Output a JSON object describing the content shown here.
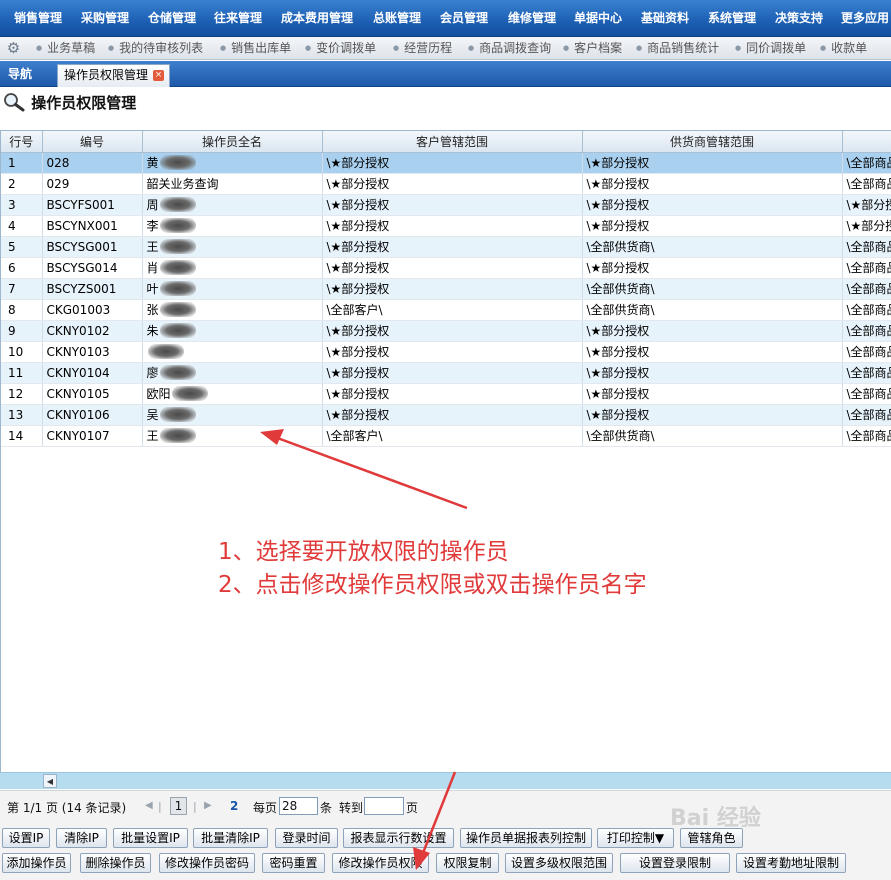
{
  "menu": [
    "销售管理",
    "采购管理",
    "仓储管理",
    "往来管理",
    "成本费用管理",
    "总账管理",
    "会员管理",
    "维修管理",
    "单据中心",
    "基础资料",
    "系统管理",
    "决策支持",
    "更多应用"
  ],
  "quickbar": [
    "业务草稿",
    "我的待审核列表",
    "销售出库单",
    "变价调拨单",
    "经营历程",
    "商品调拨查询",
    "客户档案",
    "商品销售统计",
    "同价调拨单",
    "收款单"
  ],
  "tabs": {
    "nav": "导航",
    "active": "操作员权限管理",
    "close_glyph": "×"
  },
  "page_title": "操作员权限管理",
  "grid": {
    "columns": [
      "行号",
      "编号",
      "操作员全名",
      "客户管辖范围",
      "供货商管辖范围",
      ""
    ],
    "rows": [
      {
        "no": "1",
        "code": "028",
        "name": "黄",
        "cust": "\\★部分授权",
        "supp": "\\★部分授权",
        "other": "\\全部商品"
      },
      {
        "no": "2",
        "code": "029",
        "name": "韶关业务查询",
        "cust": "\\★部分授权",
        "supp": "\\★部分授权",
        "other": "\\全部商品"
      },
      {
        "no": "3",
        "code": "BSCYFS001",
        "name": "周",
        "cust": "\\★部分授权",
        "supp": "\\★部分授权",
        "other": "\\★部分授"
      },
      {
        "no": "4",
        "code": "BSCYNX001",
        "name": "李",
        "cust": "\\★部分授权",
        "supp": "\\★部分授权",
        "other": "\\★部分授"
      },
      {
        "no": "5",
        "code": "BSCYSG001",
        "name": "王",
        "cust": "\\★部分授权",
        "supp": "\\全部供货商\\",
        "other": "\\全部商品"
      },
      {
        "no": "6",
        "code": "BSCYSG014",
        "name": "肖",
        "cust": "\\★部分授权",
        "supp": "\\★部分授权",
        "other": "\\全部商品"
      },
      {
        "no": "7",
        "code": "BSCYZS001",
        "name": "叶",
        "cust": "\\★部分授权",
        "supp": "\\全部供货商\\",
        "other": "\\全部商品"
      },
      {
        "no": "8",
        "code": "CKG01003",
        "name": "张",
        "cust": "\\全部客户\\",
        "supp": "\\全部供货商\\",
        "other": "\\全部商品"
      },
      {
        "no": "9",
        "code": "CKNY0102",
        "name": "朱",
        "cust": "\\★部分授权",
        "supp": "\\★部分授权",
        "other": "\\全部商品"
      },
      {
        "no": "10",
        "code": "CKNY0103",
        "name": "",
        "cust": "\\★部分授权",
        "supp": "\\★部分授权",
        "other": "\\全部商品"
      },
      {
        "no": "11",
        "code": "CKNY0104",
        "name": "廖",
        "cust": "\\★部分授权",
        "supp": "\\★部分授权",
        "other": "\\全部商品"
      },
      {
        "no": "12",
        "code": "CKNY0105",
        "name": "欧阳",
        "cust": "\\★部分授权",
        "supp": "\\★部分授权",
        "other": "\\全部商品"
      },
      {
        "no": "13",
        "code": "CKNY0106",
        "name": "吴",
        "cust": "\\★部分授权",
        "supp": "\\★部分授权",
        "other": "\\全部商品"
      },
      {
        "no": "14",
        "code": "CKNY0107",
        "name": "王",
        "cust": "\\全部客户\\",
        "supp": "\\全部供货商\\",
        "other": "\\全部商品"
      }
    ]
  },
  "pager": {
    "page_info": "第 1/1 页 (14 条记录)",
    "current_page": "1",
    "next_page": "2",
    "per_page_label": "每页",
    "per_page_value": "28",
    "per_page_unit": "条",
    "goto_label": "转到",
    "goto_value": "",
    "goto_unit": "页"
  },
  "buttons_row1": [
    "设置IP",
    "清除IP",
    "批量设置IP",
    "批量清除IP",
    "登录时间",
    "报表显示行数设置",
    "操作员单据报表列控制",
    "打印控制▼",
    "管辖角色"
  ],
  "buttons_row2": [
    "添加操作员",
    "删除操作员",
    "修改操作员密码",
    "密码重置",
    "修改操作员权限",
    "权限复制",
    "设置多级权限范围",
    "设置登录限制",
    "设置考勤地址限制"
  ],
  "annotation": {
    "line1": "1、选择要开放权限的操作员",
    "line2": "2、点击修改操作员权限或双击操作员名字",
    "color": "#e03a3a"
  },
  "watermark": "Bai 经验"
}
